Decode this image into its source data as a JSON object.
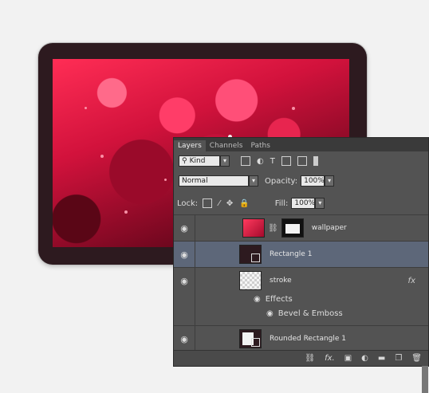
{
  "panel": {
    "tabs": [
      "Layers",
      "Channels",
      "Paths"
    ],
    "filter": {
      "label": "Kind"
    },
    "blend_mode": "Normal",
    "opacity": {
      "label": "Opacity:",
      "value": "100%"
    },
    "lock": {
      "label": "Lock:"
    },
    "fill": {
      "label": "Fill:",
      "value": "100%"
    },
    "layers": [
      {
        "name": "wallpaper"
      },
      {
        "name": "Rectangle 1"
      },
      {
        "name": "stroke",
        "fx": "fx"
      },
      {
        "effects_label": "Effects",
        "bevel_label": "Bevel & Emboss"
      },
      {
        "name": "Rounded Rectangle 1"
      }
    ],
    "bottom_icons": [
      "link-icon",
      "fx-icon",
      "mask-icon",
      "adjustment-icon",
      "folder-icon",
      "new-layer-icon",
      "trash-icon"
    ],
    "bottom_fx_text": "fx."
  },
  "colors": {
    "panel_bg": "#535353",
    "selection": "#5d6779",
    "canvas_bg": "#f2f2f2",
    "device_frame": "#2d1a1f",
    "accent_red": "#d2123c"
  }
}
